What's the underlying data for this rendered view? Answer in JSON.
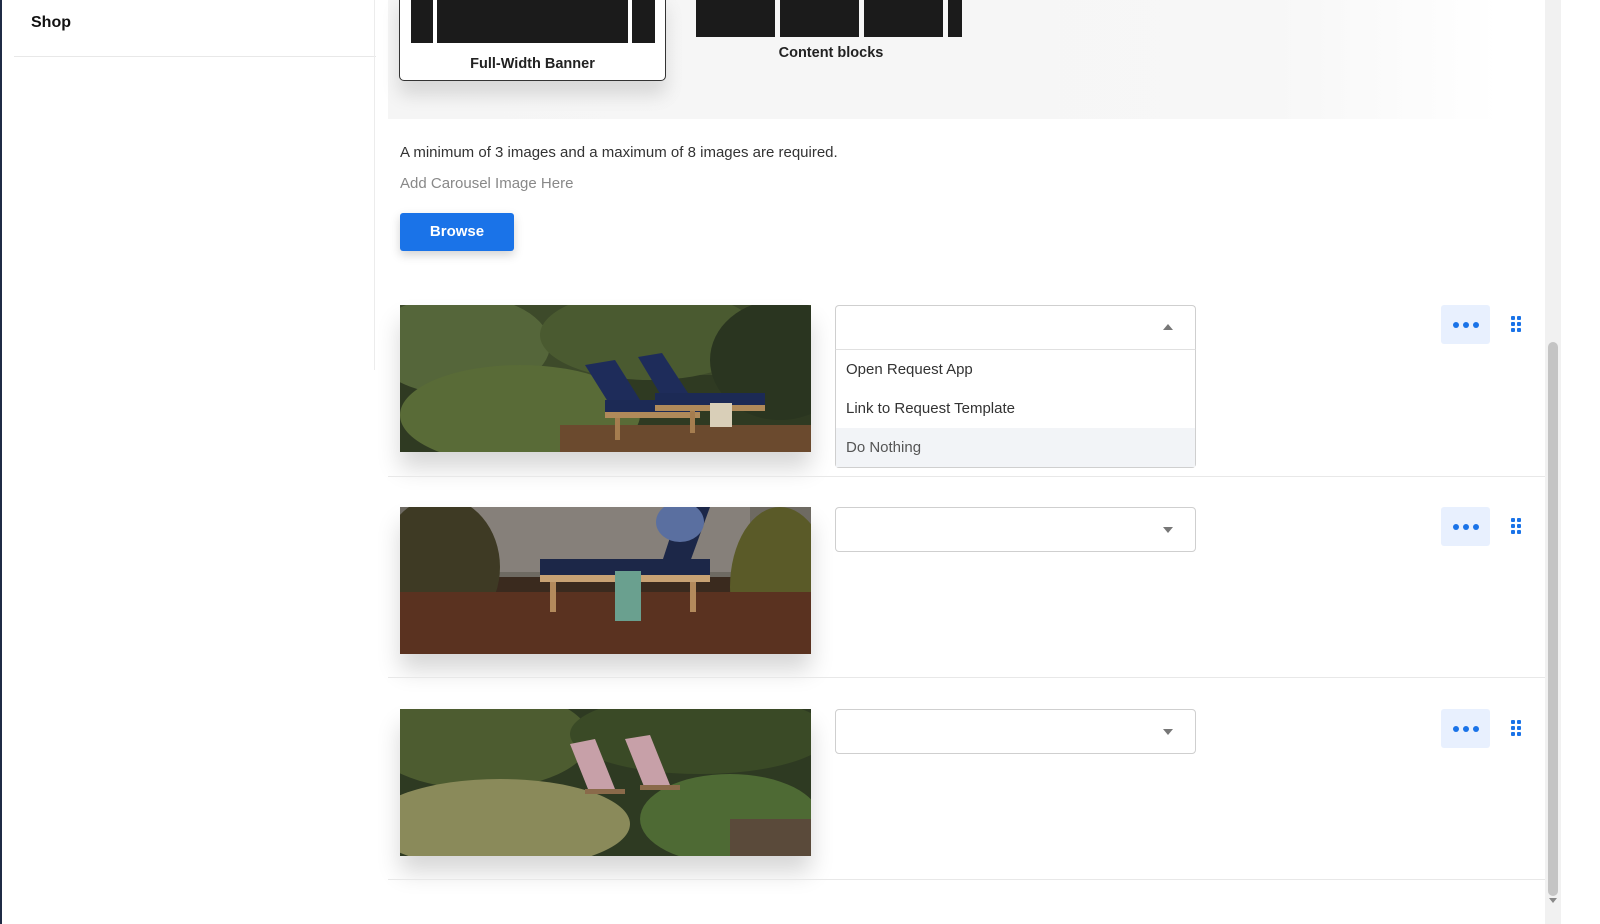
{
  "sidebar": {
    "items": [
      {
        "label": "Shop"
      }
    ]
  },
  "layout_options": {
    "full_width_banner": {
      "label": "Full-Width Banner"
    },
    "content_blocks": {
      "label": "Content blocks"
    }
  },
  "carousel": {
    "requirement_text": "A minimum of 3 images and a maximum of 8 images are required.",
    "add_image_label": "Add Carousel Image Here",
    "browse_label": "Browse",
    "rows": [
      {
        "image": "lounge-chairs-deck-photo",
        "action_value": "",
        "dropdown_open": true
      },
      {
        "image": "lounger-by-stone-wall-photo",
        "action_value": "",
        "dropdown_open": false
      },
      {
        "image": "striped-deck-chairs-garden-photo",
        "action_value": "",
        "dropdown_open": false
      }
    ],
    "dropdown_options": [
      "Open Request App",
      "Link to Request Template",
      "Do Nothing"
    ],
    "highlighted_option": "Do Nothing"
  },
  "colors": {
    "accent": "#1a73e8",
    "accent_light": "#e8f0fe",
    "sidebar_edge": "#1f2b45"
  },
  "icons": {
    "more": "more-horizontal-icon",
    "drag": "drag-handle-icon",
    "caret_up": "caret-up-icon",
    "caret_down": "caret-down-icon"
  }
}
